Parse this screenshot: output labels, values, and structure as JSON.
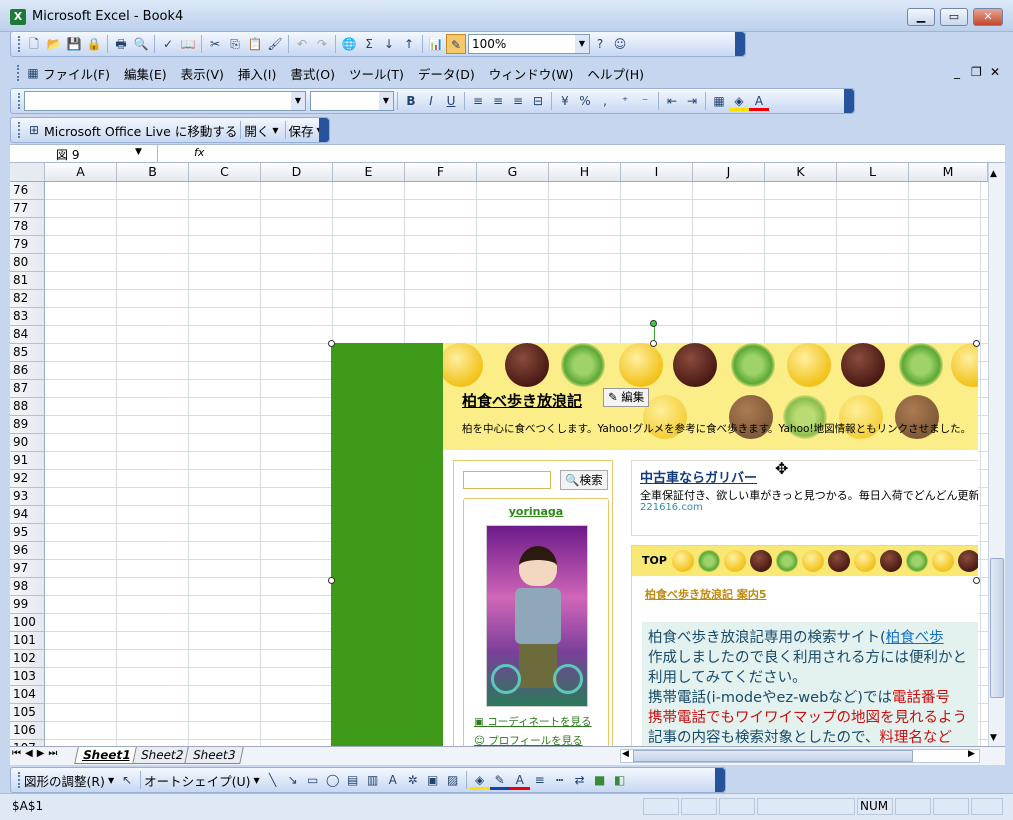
{
  "window": {
    "title": "Microsoft Excel - Book4",
    "app_icon": "X"
  },
  "std_toolbar": {
    "zoom": "100%"
  },
  "menu": [
    "ファイル(F)",
    "編集(E)",
    "表示(V)",
    "挿入(I)",
    "書式(O)",
    "ツール(T)",
    "データ(D)",
    "ウィンドウ(W)",
    "ヘルプ(H)"
  ],
  "office_live": {
    "goto": "Microsoft Office Live に移動する",
    "open": "開く",
    "save": "保存"
  },
  "name_box": "図 9",
  "fx": "fx",
  "columns": [
    "A",
    "B",
    "C",
    "D",
    "E",
    "F",
    "G",
    "H",
    "I",
    "J",
    "K",
    "L",
    "M"
  ],
  "rows": [
    "76",
    "77",
    "78",
    "79",
    "80",
    "81",
    "82",
    "83",
    "84",
    "85",
    "86",
    "87",
    "88",
    "89",
    "90",
    "91",
    "92",
    "93",
    "94",
    "95",
    "96",
    "97",
    "98",
    "99",
    "100",
    "101",
    "102",
    "103",
    "104",
    "105",
    "106",
    "107"
  ],
  "sheets": [
    "Sheet1",
    "Sheet2",
    "Sheet3"
  ],
  "drawing_toolbar": {
    "adjust": "図形の調整(R)",
    "autoshape": "オートシェイプ(U)"
  },
  "status": {
    "cell": "$A$1",
    "num": "NUM"
  },
  "blog": {
    "title": "柏食べ歩き放浪記",
    "edit": "編集",
    "description": "柏を中心に食べつくします。Yahoo!グルメを参考に食べ歩きます。Yahoo!地図情報ともリンクさせました。",
    "search_button": "検索",
    "user": "yorinaga",
    "link_coordinate": "コーディネートを見る",
    "link_profile": "プロフィールを見る",
    "ad_title": "中古車ならガリバー",
    "ad_desc": "全車保証付き、欲しい車がきっと見つかる。毎日入荷でどんどん更新",
    "ad_url": "221616.com",
    "top_label": "TOP",
    "post_link": "柏食べ歩き放浪記 案内5",
    "post_lines": [
      "柏食べ歩き放浪記専用の検索サイト(",
      "柏食べ歩",
      "作成しましたので良く利用される方には便利かと",
      "利用してみてください。",
      "携帯電話(i-modeやez-webなど)では",
      "電話番号",
      "携帯電話でもワイワイマップの地図を見れるよう",
      "記事の内容も検索対象としたので、",
      "料理名など"
    ]
  }
}
